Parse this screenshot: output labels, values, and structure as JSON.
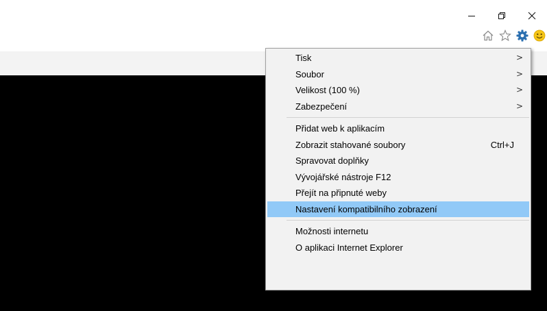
{
  "window_controls": {
    "minimize": "minimize-icon",
    "restore": "restore-icon",
    "close": "close-icon"
  },
  "toolbar": {
    "icons": [
      "home-icon",
      "favorites-star-icon",
      "tools-gear-icon",
      "feedback-smiley-icon"
    ],
    "accent_color": "#2a6fb0",
    "smiley_color": "#f5c518"
  },
  "tools_menu": {
    "highlight_color": "#91c9f7",
    "groups": [
      {
        "items": [
          {
            "label": "Tisk",
            "submenu": true
          },
          {
            "label": "Soubor",
            "submenu": true
          },
          {
            "label": "Velikost (100 %)",
            "submenu": true
          },
          {
            "label": "Zabezpečení",
            "submenu": true
          }
        ]
      },
      {
        "items": [
          {
            "label": "Přidat web k aplikacím"
          },
          {
            "label": "Zobrazit stahované soubory",
            "shortcut": "Ctrl+J"
          },
          {
            "label": "Spravovat doplňky"
          },
          {
            "label": "Vývojářské nástroje F12"
          },
          {
            "label": "Přejít na připnuté weby"
          },
          {
            "label": "Nastavení kompatibilního zobrazení",
            "highlighted": true
          }
        ]
      },
      {
        "items": [
          {
            "label": "Možnosti internetu"
          },
          {
            "label": "O aplikaci Internet Explorer"
          }
        ]
      }
    ],
    "submenu_glyph": ">"
  }
}
